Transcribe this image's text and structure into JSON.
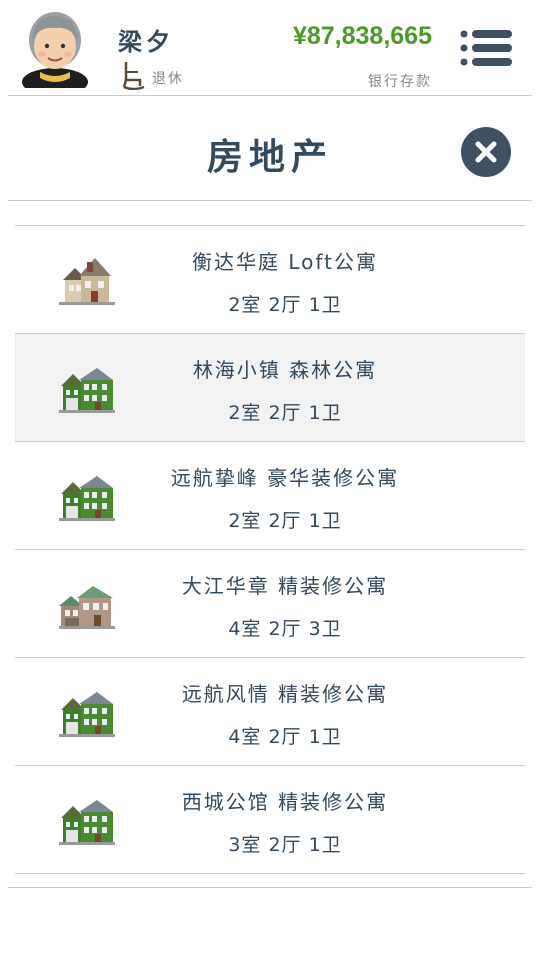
{
  "header": {
    "player_name": "梁夕",
    "status_text": "退休",
    "money": "¥87,838,665",
    "money_label": "银行存款"
  },
  "page": {
    "title": "房地产"
  },
  "colors": {
    "text_dark": "#34495e",
    "money_green": "#4a9a2a",
    "close_bg": "#3e5061",
    "selected_row": "#f2f2f2"
  },
  "properties": [
    {
      "name": "衡达华庭 Loft公寓",
      "layout": "2室 2厅 1卫",
      "icon": "tan-house-icon",
      "selected": false
    },
    {
      "name": "林海小镇 森林公寓",
      "layout": "2室 2厅 1卫",
      "icon": "green-house-icon",
      "selected": true
    },
    {
      "name": "远航挚峰 豪华装修公寓",
      "layout": "2室 2厅 1卫",
      "icon": "green-house-icon",
      "selected": false
    },
    {
      "name": "大江华章 精装修公寓",
      "layout": "4室 2厅 3卫",
      "icon": "brown-house-icon",
      "selected": false
    },
    {
      "name": "远航风情 精装修公寓",
      "layout": "4室 2厅 1卫",
      "icon": "green-house-icon",
      "selected": false
    },
    {
      "name": "西城公馆 精装修公寓",
      "layout": "3室 2厅 1卫",
      "icon": "green-house-icon",
      "selected": false
    }
  ]
}
